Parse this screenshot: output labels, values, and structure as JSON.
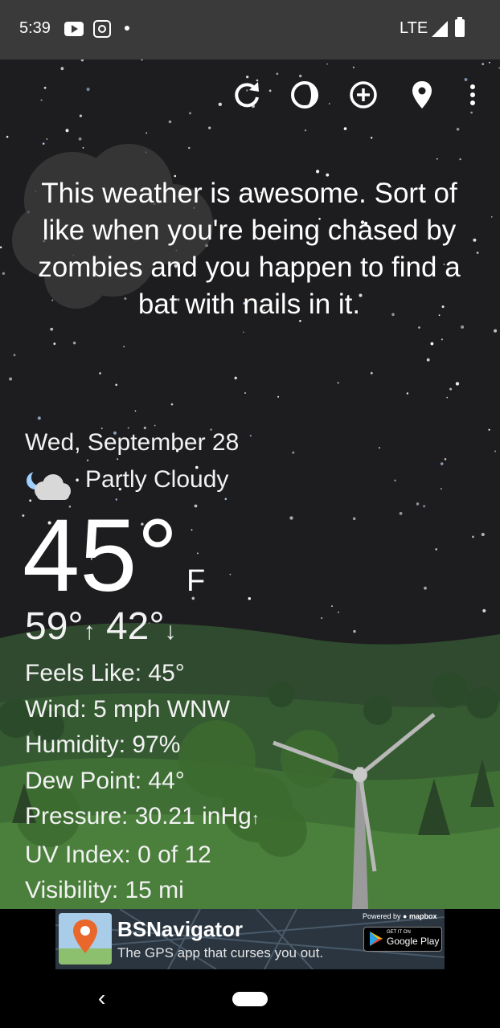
{
  "status_bar": {
    "time": "5:39",
    "network": "LTE",
    "icons": [
      "youtube-icon",
      "instagram-icon",
      "notification-dot-icon",
      "signal-icon",
      "battery-icon"
    ]
  },
  "toolbar": {
    "icons": [
      "refresh-icon",
      "moon-phase-icon",
      "add-location-icon",
      "location-pin-icon",
      "more-options-icon"
    ]
  },
  "quote": "This weather is awesome. Sort of like when you're being chased by zombies and you happen to find a bat with nails in it.",
  "weather": {
    "date": "Wed, September 28",
    "condition": "Partly Cloudy",
    "condition_icon": "night-partly-cloudy-icon",
    "temperature": "45°",
    "unit": "F",
    "high": "59°",
    "low": "42°",
    "feels_like": "Feels Like:  45°",
    "wind": "Wind:  5 mph WNW",
    "humidity": "Humidity:  97%",
    "dew_point": "Dew Point:  44°",
    "pressure": "Pressure:  30.21 inHg",
    "uv_index": "UV Index:  0 of 12",
    "visibility": "Visibility:  15 mi"
  },
  "ad": {
    "title": "BSNavigator",
    "subtitle": "The GPS app that curses you out.",
    "powered_by": "Powered by",
    "powered_brand": "mapbox",
    "store_small": "GET IT ON",
    "store_name": "Google Play"
  },
  "colors": {
    "sky": "#1d1d1f",
    "status_bar": "#3a3a3a",
    "hill_near": "#3f6f35",
    "hill_far": "#2e4a2c"
  }
}
